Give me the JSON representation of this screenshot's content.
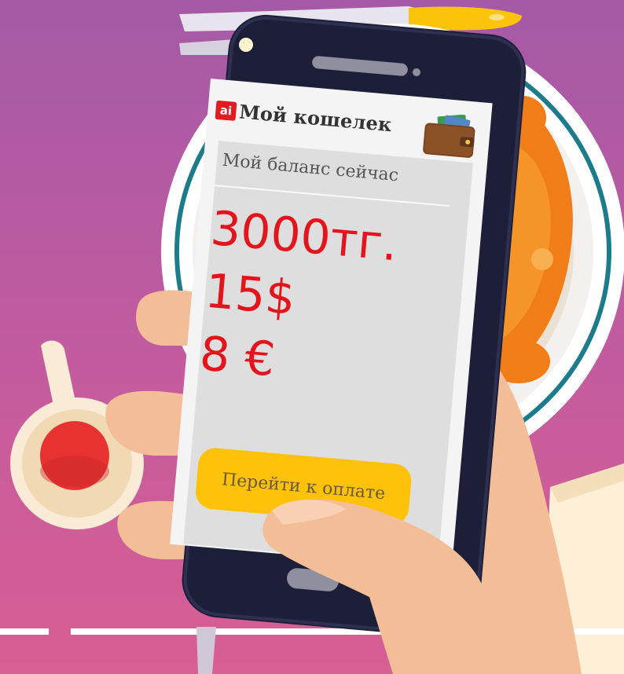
{
  "app": {
    "logo_text": "ai",
    "title": "Мой кошелек"
  },
  "balance": {
    "label": "Мой баланс сейчас",
    "amounts": [
      "3000тг.",
      "15$",
      "8 €"
    ]
  },
  "actions": {
    "pay_label": "Перейти к оплате"
  },
  "icons": [
    "wallet-icon",
    "camera-icon",
    "speaker-icon",
    "home-button-icon"
  ],
  "colors": {
    "amount": "#e3141c",
    "button": "#fec20b",
    "logo": "#e11b22",
    "background": "#c25b9f"
  }
}
